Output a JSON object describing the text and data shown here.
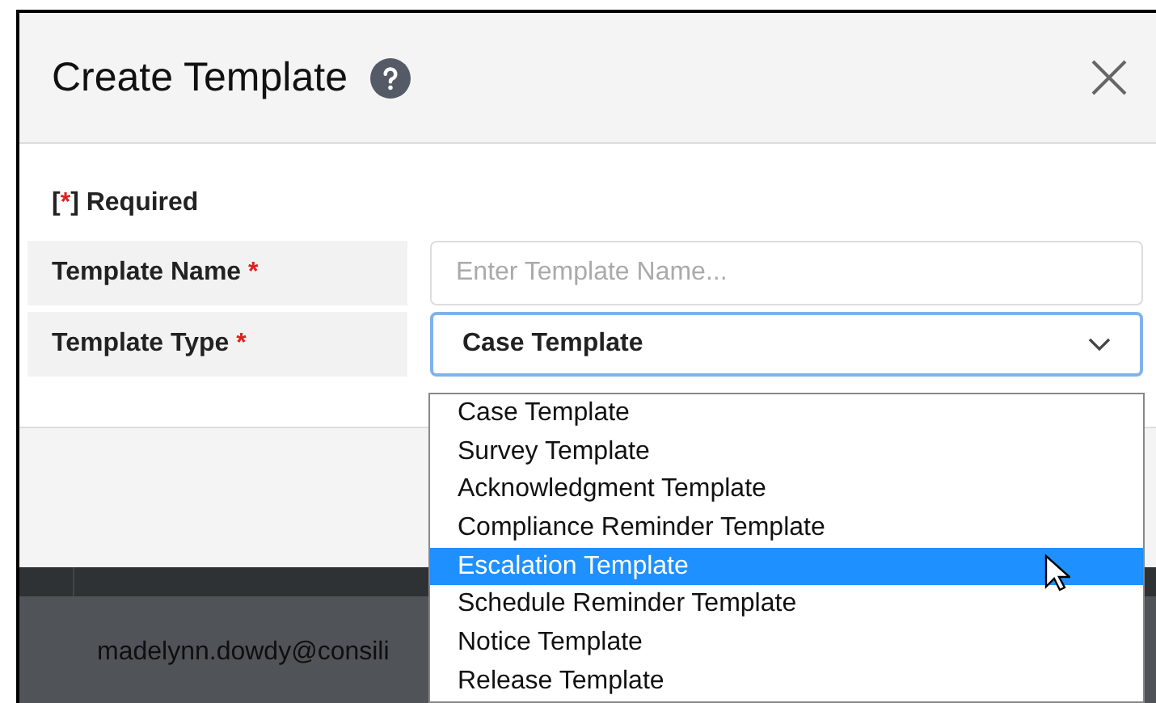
{
  "dialog": {
    "title": "Create Template",
    "required_note": {
      "open": "[",
      "mark": "*",
      "close": "] Required"
    },
    "fields": [
      {
        "kind": "text",
        "label": "Template Name",
        "required": true,
        "placeholder": "Enter Template Name..."
      },
      {
        "kind": "select",
        "label": "Template Type",
        "required": true,
        "value": "Case Template",
        "expanded": true
      }
    ],
    "options": [
      {
        "label": "Case Template",
        "highlighted": false
      },
      {
        "label": "Survey Template",
        "highlighted": false
      },
      {
        "label": "Acknowledgment Template",
        "highlighted": false
      },
      {
        "label": "Compliance Reminder Template",
        "highlighted": false
      },
      {
        "label": "Escalation Template",
        "highlighted": true
      },
      {
        "label": "Schedule Reminder Template",
        "highlighted": false
      },
      {
        "label": "Notice Template",
        "highlighted": false
      },
      {
        "label": "Release Template",
        "highlighted": false
      }
    ]
  },
  "background_row": {
    "email": "madelynn.dowdy@consili"
  }
}
